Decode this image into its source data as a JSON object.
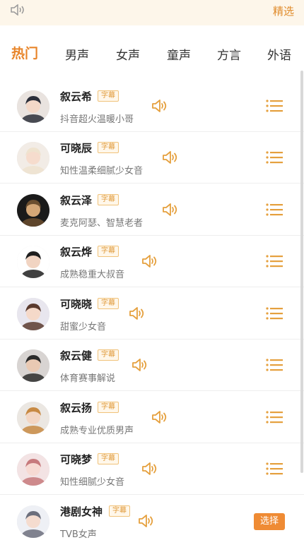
{
  "topbar": {
    "pick_label": "精选",
    "speaker_icon": "speaker-icon"
  },
  "tabs": [
    {
      "label": "热门",
      "active": true
    },
    {
      "label": "男声",
      "active": false
    },
    {
      "label": "女声",
      "active": false
    },
    {
      "label": "童声",
      "active": false
    },
    {
      "label": "方言",
      "active": false
    },
    {
      "label": "外语",
      "active": false
    }
  ],
  "voices": [
    {
      "name": "叙云希",
      "badge": "字幕",
      "desc": "抖音超火温暖小哥",
      "action": "menu"
    },
    {
      "name": "可晓辰",
      "badge": "字幕",
      "desc": "知性温柔细腻少女音",
      "action": "menu"
    },
    {
      "name": "叙云泽",
      "badge": "字幕",
      "desc": "麦克阿瑟、智慧老者",
      "action": "menu"
    },
    {
      "name": "叙云烨",
      "badge": "字幕",
      "desc": "成熟稳重大叔音",
      "action": "menu"
    },
    {
      "name": "可晓晓",
      "badge": "字幕",
      "desc": "甜蜜少女音",
      "action": "menu"
    },
    {
      "name": "叙云健",
      "badge": "字幕",
      "desc": "体育赛事解说",
      "action": "menu"
    },
    {
      "name": "叙云扬",
      "badge": "字幕",
      "desc": "成熟专业优质男声",
      "action": "menu"
    },
    {
      "name": "可晓梦",
      "badge": "字幕",
      "desc": "知性细腻少女音",
      "action": "menu"
    },
    {
      "name": "港剧女神",
      "badge": "字幕",
      "desc": "TVB女声",
      "action": "select",
      "select_label": "选择"
    }
  ],
  "colors": {
    "accent": "#e8852a",
    "badge_border": "#f0c27a",
    "button": "#ef8b34"
  }
}
